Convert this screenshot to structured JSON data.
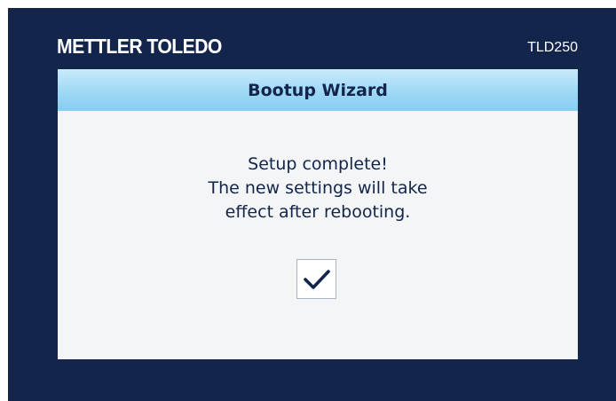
{
  "device": {
    "brand": "METTLER TOLEDO",
    "model": "TLD250"
  },
  "dialog": {
    "title": "Bootup Wizard",
    "message_lines": [
      "Setup complete!",
      "The new settings will take",
      "effect after rebooting."
    ],
    "confirm_icon": "checkmark-icon"
  },
  "colors": {
    "screen_background": "#13254a",
    "dialog_background": "#f3f5f7",
    "header_gradient_top": "#c9ebfb",
    "header_gradient_bottom": "#86cdf1",
    "text": "#13254a"
  }
}
